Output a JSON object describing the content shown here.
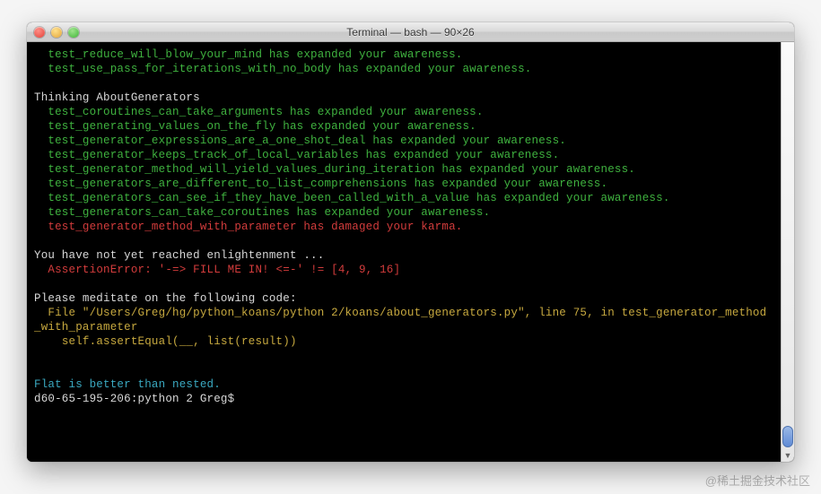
{
  "window": {
    "title": "Terminal — bash — 90×26"
  },
  "lines": [
    {
      "cls": "g",
      "text": "  test_reduce_will_blow_your_mind has expanded your awareness."
    },
    {
      "cls": "g",
      "text": "  test_use_pass_for_iterations_with_no_body has expanded your awareness."
    },
    {
      "cls": "",
      "text": " "
    },
    {
      "cls": "",
      "text": "Thinking AboutGenerators"
    },
    {
      "cls": "g",
      "text": "  test_coroutines_can_take_arguments has expanded your awareness."
    },
    {
      "cls": "g",
      "text": "  test_generating_values_on_the_fly has expanded your awareness."
    },
    {
      "cls": "g",
      "text": "  test_generator_expressions_are_a_one_shot_deal has expanded your awareness."
    },
    {
      "cls": "g",
      "text": "  test_generator_keeps_track_of_local_variables has expanded your awareness."
    },
    {
      "cls": "g",
      "text": "  test_generator_method_will_yield_values_during_iteration has expanded your awareness."
    },
    {
      "cls": "g",
      "text": "  test_generators_are_different_to_list_comprehensions has expanded your awareness."
    },
    {
      "cls": "g",
      "text": "  test_generators_can_see_if_they_have_been_called_with_a_value has expanded your awareness."
    },
    {
      "cls": "g",
      "text": "  test_generators_can_take_coroutines has expanded your awareness."
    },
    {
      "cls": "r",
      "text": "  test_generator_method_with_parameter has damaged your karma."
    },
    {
      "cls": "",
      "text": " "
    },
    {
      "cls": "",
      "text": "You have not yet reached enlightenment ..."
    },
    {
      "cls": "r",
      "text": "  AssertionError: '-=> FILL ME IN! <=-' != [4, 9, 16]"
    },
    {
      "cls": "",
      "text": " "
    },
    {
      "cls": "",
      "text": "Please meditate on the following code:"
    },
    {
      "cls": "y",
      "text": "  File \"/Users/Greg/hg/python_koans/python 2/koans/about_generators.py\", line 75, in test_generator_method_with_parameter"
    },
    {
      "cls": "y",
      "text": "    self.assertEqual(__, list(result))"
    },
    {
      "cls": "",
      "text": " "
    },
    {
      "cls": "",
      "text": " "
    },
    {
      "cls": "c",
      "text": "Flat is better than nested."
    },
    {
      "cls": "",
      "text": "d60-65-195-206:python 2 Greg$ "
    }
  ],
  "watermark": "@稀土掘金技术社区"
}
